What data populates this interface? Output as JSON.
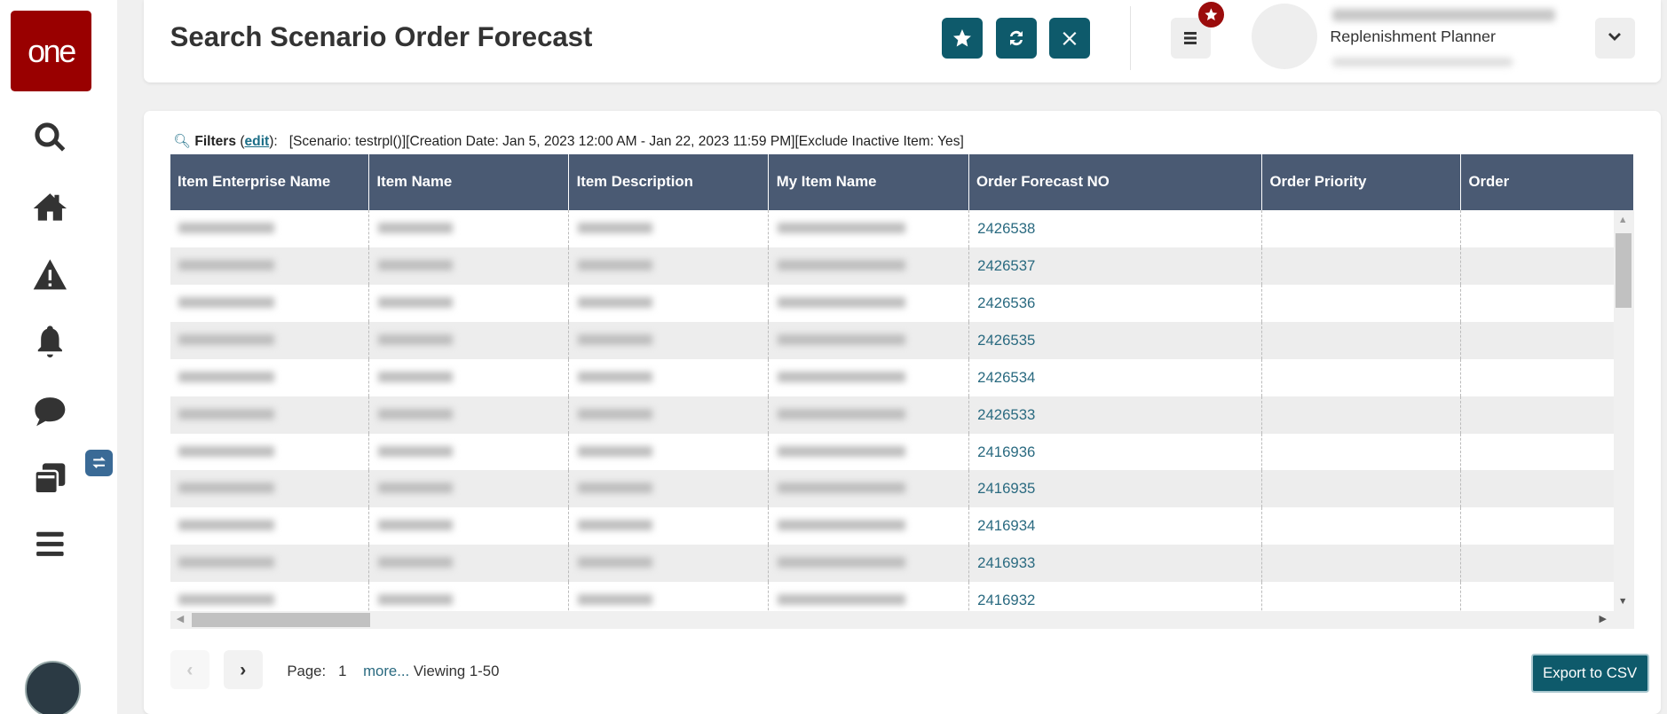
{
  "logo": {
    "text": "one",
    "color": "#990000"
  },
  "sidebar": {
    "items": [
      {
        "icon": "search-icon"
      },
      {
        "icon": "home-icon"
      },
      {
        "icon": "warning-icon"
      },
      {
        "icon": "bell-icon"
      },
      {
        "icon": "chat-icon"
      },
      {
        "icon": "documents-icon"
      },
      {
        "icon": "menu-icon"
      }
    ]
  },
  "header": {
    "title": "Search Scenario Order Forecast",
    "buttons": [
      "star-icon",
      "refresh-icon",
      "close-icon"
    ],
    "user": {
      "role": "Replenishment Planner"
    },
    "accent": "#0e5a6b"
  },
  "filters": {
    "label": "Filters",
    "edit": "edit",
    "text": "[Scenario: testrpl()][Creation Date: Jan 5, 2023 12:00 AM - Jan 22, 2023 11:59 PM][Exclude Inactive Item: Yes]"
  },
  "table": {
    "columns": [
      "Item Enterprise Name",
      "Item Name",
      "Item Description",
      "My Item Name",
      "Order Forecast NO",
      "Order Priority",
      "Order"
    ],
    "rows": [
      {
        "order_forecast_no": "2426538"
      },
      {
        "order_forecast_no": "2426537"
      },
      {
        "order_forecast_no": "2426536"
      },
      {
        "order_forecast_no": "2426535"
      },
      {
        "order_forecast_no": "2426534"
      },
      {
        "order_forecast_no": "2426533"
      },
      {
        "order_forecast_no": "2416936"
      },
      {
        "order_forecast_no": "2416935"
      },
      {
        "order_forecast_no": "2416934"
      },
      {
        "order_forecast_no": "2416933"
      },
      {
        "order_forecast_no": "2416932"
      }
    ]
  },
  "pagination": {
    "page_label": "Page:",
    "page": "1",
    "more": "more...",
    "viewing": "Viewing 1-50"
  },
  "export_label": "Export to CSV"
}
